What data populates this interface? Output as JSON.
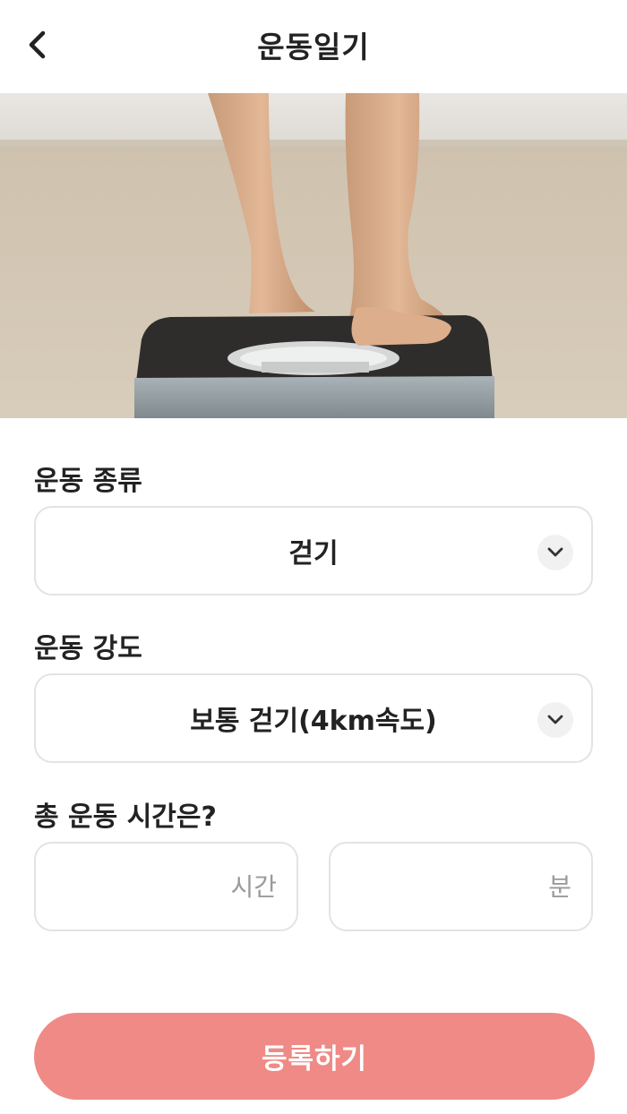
{
  "header": {
    "title": "운동일기"
  },
  "exercise_type": {
    "label": "운동 종류",
    "value": "걷기"
  },
  "intensity": {
    "label": "운동 강도",
    "value": "보통 걷기(4km속도)"
  },
  "duration": {
    "label": "총 운동 시간은?",
    "hours_placeholder": "시간",
    "minutes_placeholder": "분"
  },
  "submit": {
    "label": "등록하기"
  },
  "colors": {
    "accent": "#ef8a86",
    "border": "#e3e3e3",
    "placeholder": "#9a9a9a"
  },
  "icons": {
    "back": "chevron-left-icon",
    "dropdown": "chevron-down-icon"
  }
}
